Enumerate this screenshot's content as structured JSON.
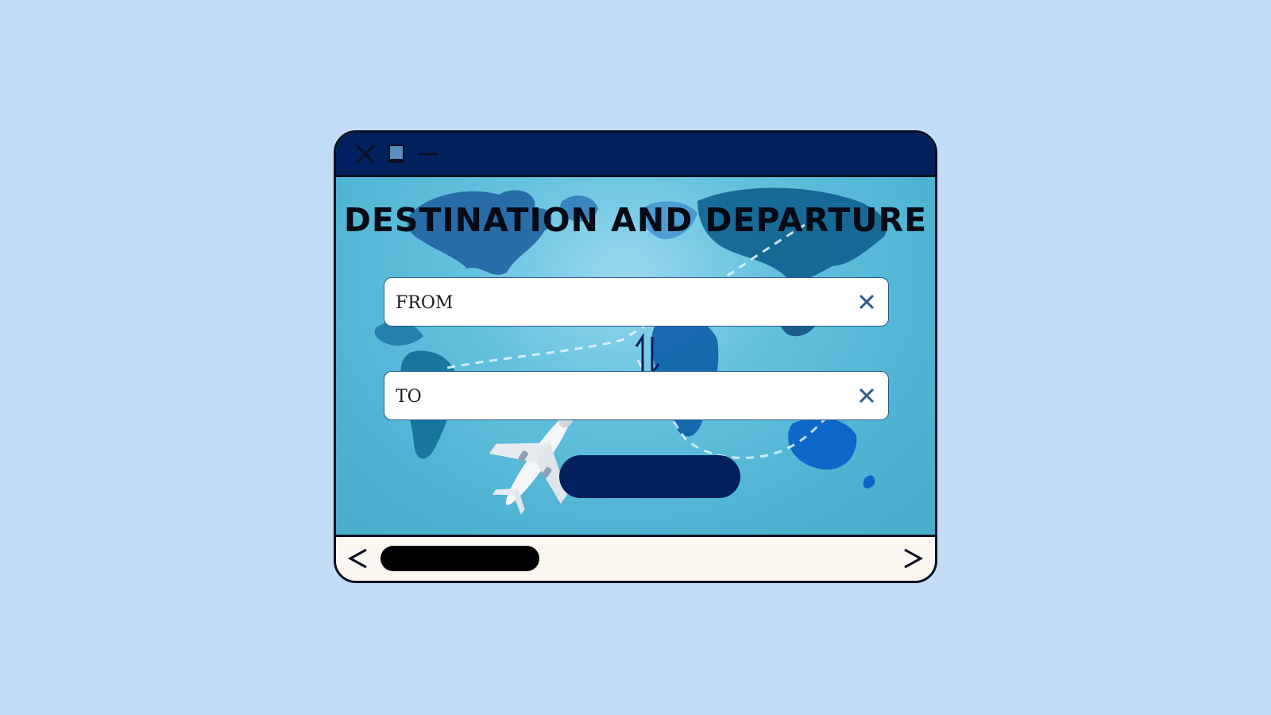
{
  "window": {
    "title_bar": {
      "buttons": [
        "close-icon",
        "maximize-icon",
        "minimize-icon"
      ],
      "color": "#03205f"
    }
  },
  "main": {
    "heading": "Destination and Departure",
    "from_field": {
      "placeholder": "FROM",
      "value": "",
      "clear_icon": "close-x-icon"
    },
    "swap_icon": "swap-vertical-arrows-icon",
    "to_field": {
      "placeholder": "TO",
      "value": "",
      "clear_icon": "close-x-icon"
    },
    "submit_button": {
      "label": "",
      "color": "#03205f"
    },
    "background": "world-map-with-airplane"
  },
  "footer": {
    "back_icon": "chevron-left-icon",
    "forward_icon": "chevron-right-icon",
    "scrollbar_color": "#000000",
    "background_color": "#fcf6f1"
  }
}
